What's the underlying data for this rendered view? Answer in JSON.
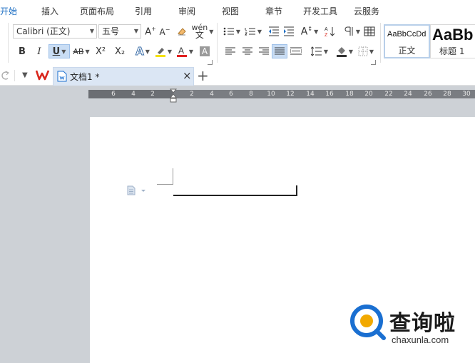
{
  "menu": {
    "tabs": [
      "开始",
      "插入",
      "页面布局",
      "引用",
      "审阅",
      "视图",
      "章节",
      "开发工具",
      "云服务"
    ],
    "active": "开始"
  },
  "ribbon": {
    "font_name": "Calibri (正文)",
    "font_size": "五号",
    "bold": "B",
    "italic": "I",
    "underline": "U",
    "strike": "AB",
    "superscript": "X²",
    "subscript": "X₂",
    "styles": [
      {
        "preview": "AaBbCcDd",
        "name": "正文"
      },
      {
        "preview": "AaBb",
        "name": "标题 1"
      }
    ]
  },
  "docbar": {
    "doc_title": "文档1 *",
    "close_glyph": "×",
    "new_tab_glyph": "+"
  },
  "ruler": {
    "ticks": [
      "6",
      "4",
      "2",
      "2",
      "4",
      "6",
      "8",
      "10",
      "12",
      "14",
      "16",
      "18",
      "20",
      "22",
      "24",
      "26",
      "28",
      "30"
    ]
  },
  "watermark": {
    "brand": "查询啦",
    "url": "chaxunla.com"
  },
  "colors": {
    "accent": "#1e6fc3",
    "font_color_bar": "#e02020",
    "highlight_bar": "#f5e100",
    "logo_red": "#d9261c",
    "logo_blue": "#1a6fd1",
    "logo_yellow": "#f2a900"
  }
}
